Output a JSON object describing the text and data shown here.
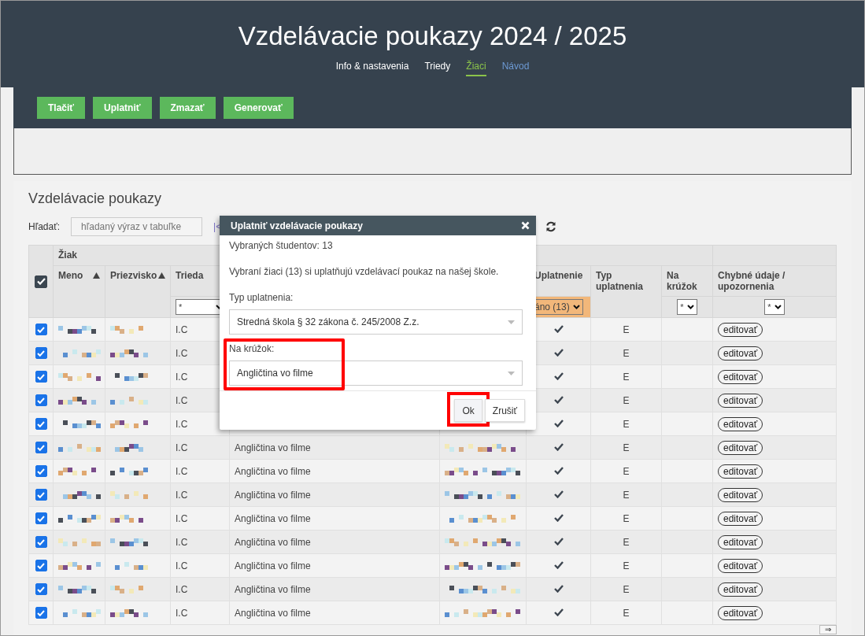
{
  "header": {
    "title": "Vzdelávacie poukazy 2024 / 2025",
    "nav": [
      {
        "label": "Info & nastavenia",
        "selected": false,
        "kind": "tab"
      },
      {
        "label": "Triedy",
        "selected": false,
        "kind": "tab"
      },
      {
        "label": "Žiaci",
        "selected": true,
        "kind": "tab"
      },
      {
        "label": "Návod",
        "selected": false,
        "kind": "link"
      }
    ]
  },
  "toolbar": [
    "Tlačiť",
    "Uplatniť",
    "Zmazať",
    "Generovať"
  ],
  "section": {
    "title": "Vzdelávacie poukazy",
    "search_label": "Hľadať:",
    "search_placeholder": "hľadaný výraz v tabuľke",
    "pager_first": "|<"
  },
  "table": {
    "select_all_checked": true,
    "group": "Žiak",
    "columns": {
      "name": "Meno",
      "surname": "Priezvisko",
      "class": "Trieda",
      "applied": "Uplatnenie",
      "type": "Typ uplatnenia",
      "club": "Na krúžok",
      "errors": "Chybné údaje / upozornenia"
    },
    "filters": {
      "class": "*",
      "applied": "áno (13)",
      "club": "*",
      "errors": "*"
    },
    "rows": [
      {
        "checked": true,
        "class": "I.C",
        "applied": true,
        "type": "E",
        "action": "editovať"
      },
      {
        "checked": true,
        "class": "I.C",
        "applied": true,
        "type": "E",
        "action": "editovať"
      },
      {
        "checked": true,
        "class": "I.C",
        "applied": true,
        "type": "E",
        "action": "editovať"
      },
      {
        "checked": true,
        "class": "I.C",
        "applied": true,
        "type": "E",
        "action": "editovať"
      },
      {
        "checked": true,
        "class": "I.C",
        "applied": true,
        "type": "E",
        "action": "editovať"
      },
      {
        "checked": true,
        "class": "I.C",
        "course": "Angličtina vo filme",
        "applied": true,
        "type": "E",
        "action": "editovať"
      },
      {
        "checked": true,
        "class": "I.C",
        "course": "Angličtina vo filme",
        "applied": true,
        "type": "E",
        "action": "editovať"
      },
      {
        "checked": true,
        "class": "I.C",
        "course": "Angličtina vo filme",
        "applied": true,
        "type": "E",
        "action": "editovať"
      },
      {
        "checked": true,
        "class": "I.C",
        "course": "Angličtina vo filme",
        "applied": true,
        "type": "E",
        "action": "editovať"
      },
      {
        "checked": true,
        "class": "I.C",
        "course": "Angličtina vo filme",
        "applied": true,
        "type": "E",
        "action": "editovať"
      },
      {
        "checked": true,
        "class": "I.C",
        "course": "Angličtina vo filme",
        "applied": true,
        "type": "E",
        "action": "editovať"
      },
      {
        "checked": true,
        "class": "I.C",
        "course": "Angličtina vo filme",
        "applied": true,
        "type": "E",
        "action": "editovať"
      },
      {
        "checked": true,
        "class": "I.C",
        "course": "Angličtina vo filme",
        "applied": true,
        "type": "E",
        "action": "editovať"
      }
    ],
    "scroll_button": "⇒"
  },
  "dialog": {
    "title": "Uplatniť vzdelávacie poukazy",
    "count_text": "Vybraných študentov: 13",
    "message": "Vybraní žiaci (13) si uplatňujú vzdelávací poukaz na našej škole.",
    "type_label": "Typ uplatnenia:",
    "type_value": "Stredná škola § 32 zákona č. 245/2008 Z.z.",
    "club_label": "Na krúžok:",
    "club_value": "Angličtina vo filme",
    "buttons": [
      "Ok",
      "Zrušiť"
    ]
  }
}
